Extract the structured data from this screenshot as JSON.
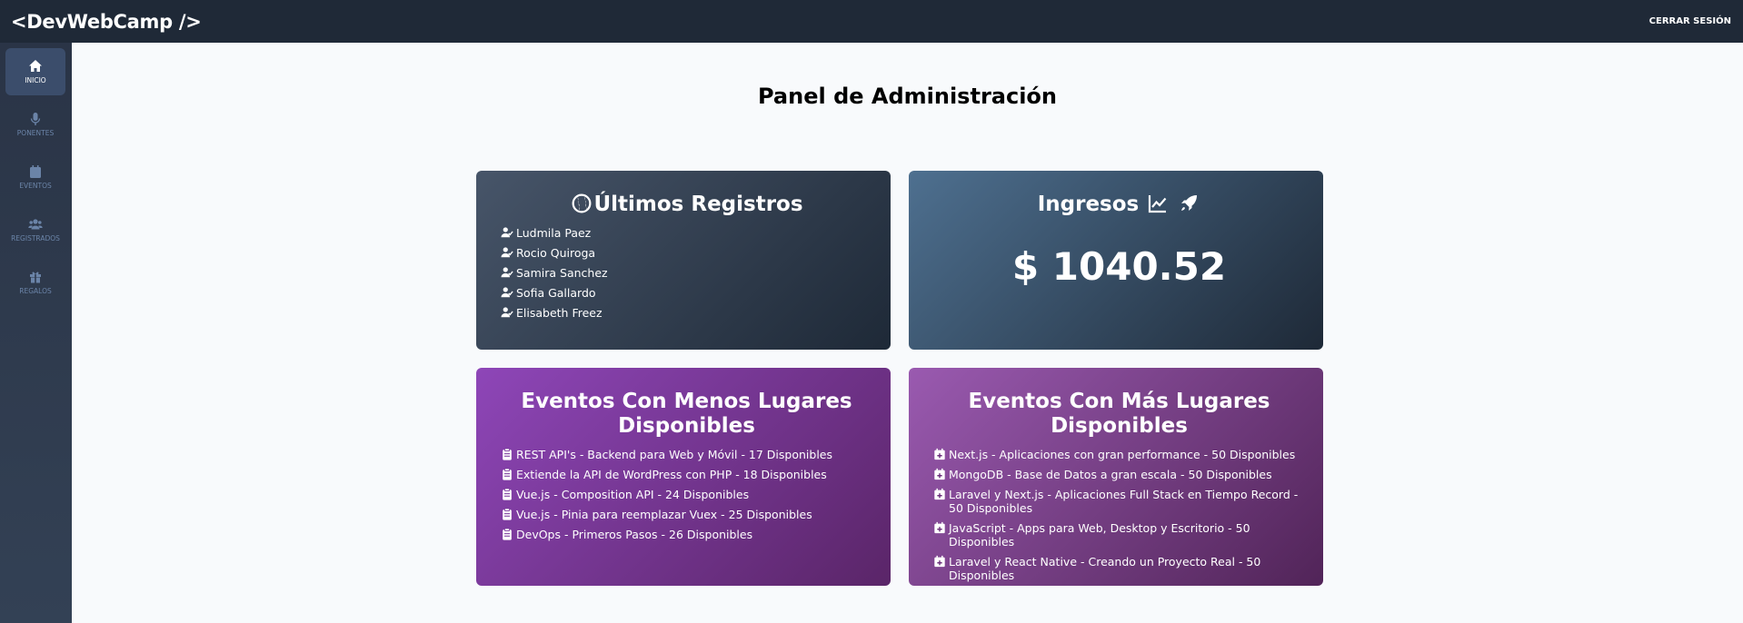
{
  "header": {
    "logo": "<DevWebCamp />",
    "logout": "CERRAR SESIÓN"
  },
  "sidebar": {
    "items": [
      {
        "label": "INICIO",
        "icon": "home-icon",
        "active": true
      },
      {
        "label": "PONENTES",
        "icon": "microphone-icon",
        "active": false
      },
      {
        "label": "EVENTOS",
        "icon": "calendar-icon",
        "active": false
      },
      {
        "label": "REGISTRADOS",
        "icon": "users-icon",
        "active": false
      },
      {
        "label": "REGALOS",
        "icon": "gift-icon",
        "active": false
      }
    ]
  },
  "main": {
    "title": "Panel de Administración",
    "latest": {
      "title": "Últimos Registros",
      "items": [
        "Ludmila Paez",
        "Rocio Quiroga",
        "Samira Sanchez",
        "Sofia Gallardo",
        "Elisabeth Freez"
      ]
    },
    "revenue": {
      "title": "Ingresos",
      "amount": "$ 1040.52"
    },
    "fewest": {
      "title": "Eventos Con Menos Lugares Disponibles",
      "items": [
        "REST API's - Backend para Web y Móvil - 17 Disponibles",
        "Extiende la API de WordPress con PHP - 18 Disponibles",
        "Vue.js - Composition API - 24 Disponibles",
        "Vue.js - Pinia para reemplazar Vuex - 25 Disponibles",
        "DevOps - Primeros Pasos - 26 Disponibles"
      ]
    },
    "most": {
      "title": "Eventos Con Más Lugares Disponibles",
      "items": [
        "Next.js - Aplicaciones con gran performance - 50 Disponibles",
        "MongoDB - Base de Datos a gran escala - 50 Disponibles",
        "Laravel y Next.js - Aplicaciones Full Stack en Tiempo Record - 50 Disponibles",
        "JavaScript - Apps para Web, Desktop y Escritorio - 50 Disponibles",
        "Laravel y React Native - Creando un Proyecto Real - 50 Disponibles"
      ]
    }
  },
  "colors": {
    "topbar": "#1f2937",
    "sidebar": "#334155",
    "purple": "#8e46b8"
  }
}
